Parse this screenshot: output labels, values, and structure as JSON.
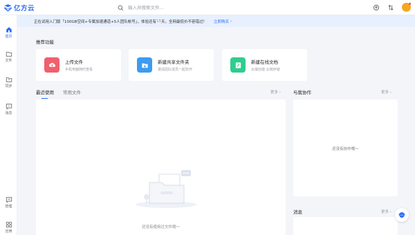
{
  "header": {
    "app_name": "亿方云",
    "search_placeholder": "输入并搜索文件..."
  },
  "notice": {
    "text_before": "正在试用入门版「100GB空间+专属加速通道+5人团队帐号」，体验还有",
    "highlight": "15",
    "text_after": "天，全网最低价不容错过！",
    "link_label": "立即购买"
  },
  "sidebar": {
    "items": [
      {
        "label": "首页",
        "icon": "home-icon",
        "active": true
      },
      {
        "label": "文件",
        "icon": "folder-icon",
        "active": false
      },
      {
        "label": "同步",
        "icon": "sync-icon",
        "active": false
      },
      {
        "label": "消息",
        "icon": "message-icon",
        "active": false
      },
      {
        "label": "管理",
        "icon": "manage-icon",
        "active": false
      },
      {
        "label": "应用",
        "icon": "apps-icon",
        "active": false
      }
    ]
  },
  "recommend": {
    "title": "推荐功能",
    "cards": [
      {
        "title": "上传文件",
        "desc": "手机电脑随时查看",
        "icon": "upload-icon",
        "color": "#f0606d"
      },
      {
        "title": "新建共享文件夹",
        "desc": "邀请团队成员一起协作",
        "icon": "shared-folder-icon",
        "color": "#3d9bf0"
      },
      {
        "title": "新建在线文档",
        "desc": "云端创建·云端存储",
        "icon": "online-doc-icon",
        "color": "#2fcd8f"
      }
    ]
  },
  "tabs": {
    "recent_label": "最近使用",
    "frequent_label": "常用文件",
    "more_label": "更多"
  },
  "recent": {
    "empty_text": "还没有使用过文件哦～"
  },
  "collab": {
    "title": "与我协作",
    "more_label": "更多",
    "empty_text": "还没有协作哦～"
  },
  "messages": {
    "title": "消息",
    "more_label": "更多"
  },
  "colors": {
    "accent": "#2b6cf6",
    "notice_bg": "#e8f0fe",
    "highlight": "#e67e22"
  }
}
